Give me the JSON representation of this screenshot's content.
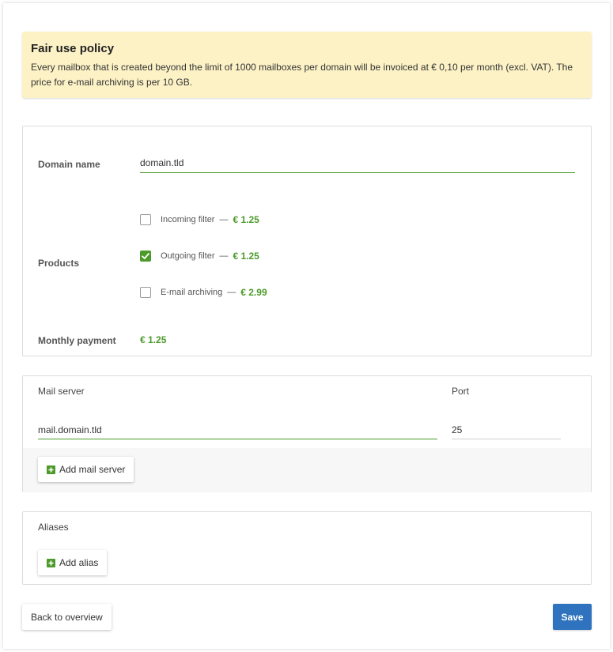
{
  "notice": {
    "title": "Fair use policy",
    "text": "Every mailbox that is created beyond the limit of 1000 mailboxes per domain will be invoiced at € 0,10 per month (excl. VAT). The price for e-mail archiving is per 10 GB."
  },
  "domain": {
    "label": "Domain name",
    "value": "domain.tld"
  },
  "products": {
    "label": "Products",
    "items": [
      {
        "name": "Incoming filter",
        "dash": "—",
        "price": "€ 1.25",
        "checked": false
      },
      {
        "name": "Outgoing filter",
        "dash": "—",
        "price": "€ 1.25",
        "checked": true
      },
      {
        "name": "E-mail archiving",
        "dash": "—",
        "price": "€ 2.99",
        "checked": false
      }
    ]
  },
  "monthly": {
    "label": "Monthly payment",
    "value": "€ 1.25"
  },
  "mail_server": {
    "server_label": "Mail server",
    "port_label": "Port",
    "server_value": "mail.domain.tld",
    "port_value": "25",
    "add_label": "Add mail server"
  },
  "aliases": {
    "label": "Aliases",
    "add_label": "Add alias"
  },
  "footer": {
    "back_label": "Back to overview",
    "save_label": "Save"
  },
  "colors": {
    "accent_green": "#4c9a2a",
    "primary_blue": "#2f72bd",
    "notice_bg": "#fdf2c6"
  }
}
